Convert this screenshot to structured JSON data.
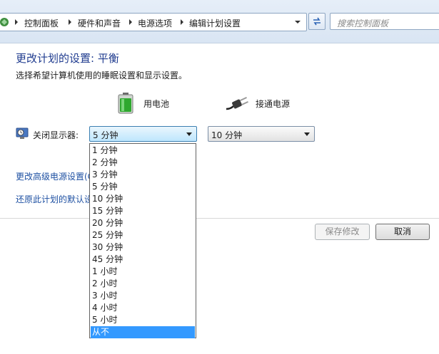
{
  "address_bar": {
    "breadcrumbs": [
      "控制面板",
      "硬件和声音",
      "电源选项",
      "编辑计划设置"
    ],
    "search_placeholder": "搜索控制面板"
  },
  "main": {
    "heading": "更改计划的设置: 平衡",
    "subtext": "选择希望计算机使用的睡眠设置和显示设置。",
    "columns": {
      "battery_label": "用电池",
      "plugged_label": "接通电源"
    },
    "display_setting": {
      "label": "关闭显示器:",
      "battery_value": "5 分钟",
      "plugged_value": "10 分钟"
    },
    "links": {
      "advanced": "更改高级电源设置(C)",
      "restore": "还原此计划的默认设置"
    }
  },
  "dropdown": {
    "options": [
      "1 分钟",
      "2 分钟",
      "3 分钟",
      "5 分钟",
      "10 分钟",
      "15 分钟",
      "20 分钟",
      "25 分钟",
      "30 分钟",
      "45 分钟",
      "1 小时",
      "2 小时",
      "3 小时",
      "4 小时",
      "5 小时",
      "从不"
    ],
    "selected_index": 15
  },
  "buttons": {
    "save": "保存修改",
    "cancel": "取消"
  },
  "colors": {
    "heading": "#1f3b8f",
    "link": "#1e50a2",
    "selection": "#3399ff"
  }
}
